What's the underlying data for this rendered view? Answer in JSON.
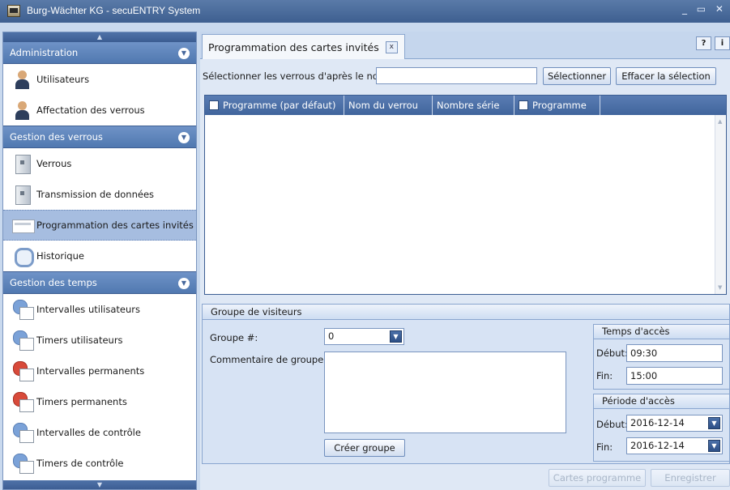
{
  "window": {
    "title": "Burg-Wächter KG - secuENTRY System",
    "controls": "_ ▭ ✕"
  },
  "nav": {
    "scroll_up": "▲",
    "scroll_down": "▼",
    "groups": [
      {
        "title": "Administration",
        "items": [
          {
            "label": "Utilisateurs",
            "icon": "user-icon"
          },
          {
            "label": "Affectation des verrous",
            "icon": "user-lock-icon"
          }
        ]
      },
      {
        "title": "Gestion des verrous",
        "items": [
          {
            "label": "Verrous",
            "icon": "lock-icon"
          },
          {
            "label": "Transmission de données",
            "icon": "transmission-icon"
          },
          {
            "label": "Programmation des cartes invités",
            "icon": "guest-card-icon",
            "selected": true
          },
          {
            "label": "Historique",
            "icon": "history-icon"
          }
        ]
      },
      {
        "title": "Gestion des temps",
        "items": [
          {
            "label": "Intervalles utilisateurs",
            "icon": "user-interval-icon"
          },
          {
            "label": "Timers utilisateurs",
            "icon": "user-timer-icon"
          },
          {
            "label": "Intervalles permanents",
            "icon": "permanent-interval-icon"
          },
          {
            "label": "Timers permanents",
            "icon": "permanent-timer-icon"
          },
          {
            "label": "Intervalles de contrôle",
            "icon": "control-interval-icon"
          },
          {
            "label": "Timers de contrôle",
            "icon": "control-timer-icon"
          }
        ]
      }
    ]
  },
  "tab": {
    "title": "Programmation des cartes invités",
    "close": "x",
    "help": "?",
    "info": "i"
  },
  "lock_selection": {
    "label": "Sélectionner les verrous d'après le nom:",
    "input_value": "",
    "select_button": "Sélectionner",
    "clear_button": "Effacer la sélection"
  },
  "grid": {
    "columns": [
      "Programme (par défaut)",
      "Nom du verrou",
      "Nombre série",
      "Programme"
    ],
    "rows": []
  },
  "visitor_group": {
    "title": "Groupe de visiteurs",
    "group_label": "Groupe #:",
    "group_value": "0",
    "comment_label": "Commentaire de groupe:",
    "comment_value": "",
    "create_button": "Créer groupe"
  },
  "access_time": {
    "title": "Temps d'accès",
    "start_label": "Début:",
    "start_value": "09:30",
    "end_label": "Fin:",
    "end_value": "15:00"
  },
  "access_period": {
    "title": "Période d'accès",
    "start_label": "Début:",
    "start_value": "2016-12-14",
    "end_label": "Fin:",
    "end_value": "2016-12-14"
  },
  "footer": {
    "program_cards_button": "Cartes programme",
    "save_button": "Enregistrer"
  },
  "colors": {
    "nav_header": "#5078b0",
    "selected_item": "#a6bde0",
    "grid_header": "#4a6fa8"
  }
}
